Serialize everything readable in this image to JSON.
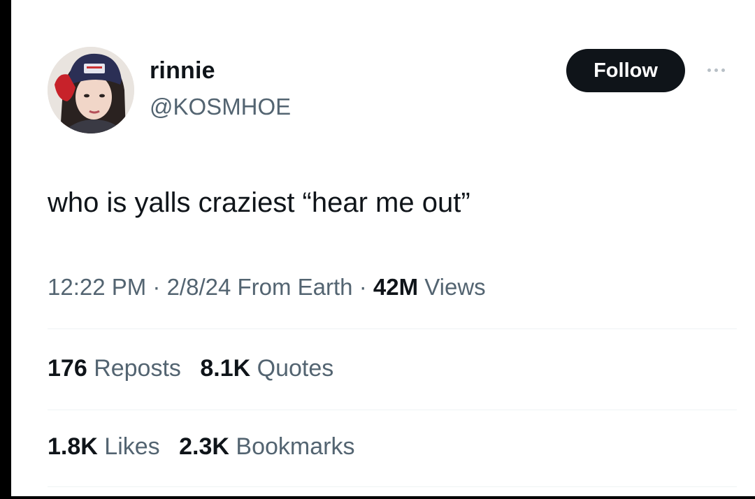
{
  "user": {
    "display_name": "rinnie",
    "handle": "@KOSMHOE",
    "avatar": "profile-photo"
  },
  "actions": {
    "follow_label": "Follow",
    "more_icon": "more-horizontal-icon"
  },
  "tweet": {
    "text": "who is yalls craziest “hear me out”"
  },
  "meta": {
    "time": "12:22 PM",
    "sep1": " · ",
    "date": "2/8/24",
    "location": "From Earth",
    "sep2": " · ",
    "views_count": "42M",
    "views_label": "Views"
  },
  "stats": {
    "reposts_count": "176",
    "reposts_label": "Reposts",
    "quotes_count": "8.1K",
    "quotes_label": "Quotes",
    "likes_count": "1.8K",
    "likes_label": "Likes",
    "bookmarks_count": "2.3K",
    "bookmarks_label": "Bookmarks"
  },
  "colors": {
    "text_primary": "#0f1419",
    "text_secondary": "#536471",
    "follow_bg": "#0f1419",
    "divider": "#eff3f4"
  }
}
